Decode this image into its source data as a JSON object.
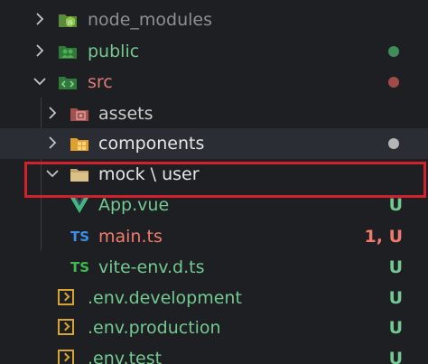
{
  "explorer": {
    "items": [
      {
        "name": "node_modules",
        "kind": "folder",
        "expanded": false,
        "color": "#8f8f8f",
        "icon": "node-folder-icon",
        "status_dot": ""
      },
      {
        "name": "public",
        "kind": "folder",
        "expanded": false,
        "color": "#73c991",
        "icon": "public-folder-icon",
        "status_dot": "#3e8d5a"
      },
      {
        "name": "src",
        "kind": "folder",
        "expanded": true,
        "color": "#e2797a",
        "icon": "src-folder-icon",
        "status_dot": "#a04b47"
      },
      {
        "name": "assets",
        "kind": "folder",
        "expanded": false,
        "color": "#cccccc",
        "icon": "assets-folder-icon",
        "status_dot": ""
      },
      {
        "name": "components",
        "kind": "folder",
        "expanded": false,
        "color": "#e6e6e6",
        "icon": "components-folder-icon",
        "status_dot": "#b5b5b5"
      },
      {
        "name": "mock \\ user",
        "kind": "folder",
        "expanded": false,
        "color": "#e6e6e6",
        "icon": "folder-icon",
        "status_dot": ""
      },
      {
        "name": "App.vue",
        "kind": "file",
        "color": "#73c991",
        "icon": "vue-icon",
        "status": "U"
      },
      {
        "name": "main.ts",
        "kind": "file",
        "color": "#f07b6d",
        "icon": "typescript-icon",
        "status": "1, U"
      },
      {
        "name": "vite-env.d.ts",
        "kind": "file",
        "color": "#73c991",
        "icon": "typescript-def-icon",
        "status": "U"
      },
      {
        "name": ".env.development",
        "kind": "file",
        "color": "#73c991",
        "icon": "env-icon",
        "status": "U"
      },
      {
        "name": ".env.production",
        "kind": "file",
        "color": "#73c991",
        "icon": "env-icon",
        "status": "U"
      },
      {
        "name": ".env.test",
        "kind": "file",
        "color": "#73c991",
        "icon": "env-icon",
        "status": "U"
      }
    ],
    "ts_badge": "TS",
    "status_color": "#73c991",
    "status_color_modified": "#f07b6d",
    "highlight_color": "#d0212d"
  }
}
